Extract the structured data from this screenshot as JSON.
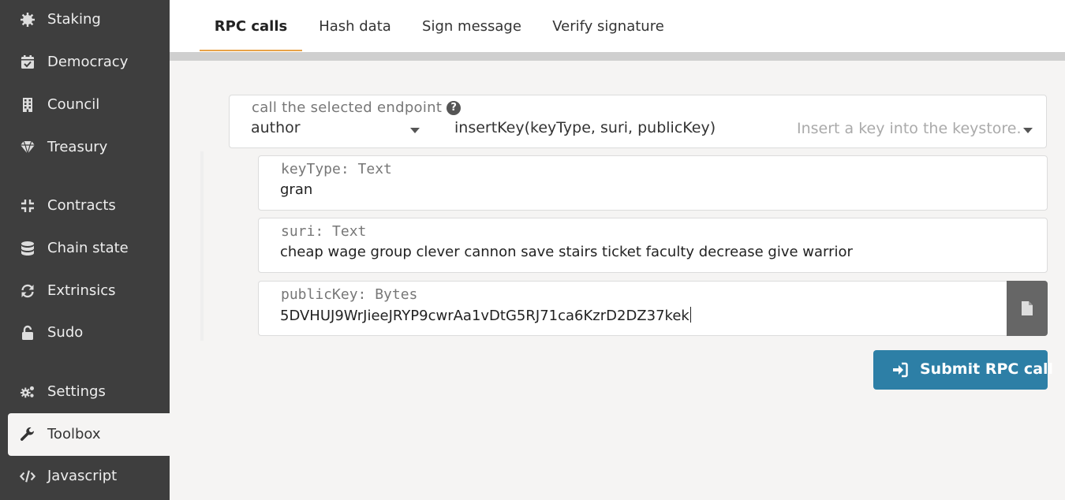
{
  "sidebar": {
    "items": [
      {
        "label": "Staking",
        "icon": "staking-icon"
      },
      {
        "label": "Democracy",
        "icon": "calendar-check-icon"
      },
      {
        "label": "Council",
        "icon": "building-icon"
      },
      {
        "label": "Treasury",
        "icon": "gem-icon"
      },
      {
        "label": "Contracts",
        "icon": "compress-icon"
      },
      {
        "label": "Chain state",
        "icon": "database-icon"
      },
      {
        "label": "Extrinsics",
        "icon": "sync-icon"
      },
      {
        "label": "Sudo",
        "icon": "unlock-icon"
      },
      {
        "label": "Settings",
        "icon": "cogs-icon"
      },
      {
        "label": "Toolbox",
        "icon": "wrench-icon",
        "active": true
      },
      {
        "label": "Javascript",
        "icon": "code-icon"
      }
    ]
  },
  "tabs": [
    {
      "label": "RPC calls",
      "active": true
    },
    {
      "label": "Hash data"
    },
    {
      "label": "Sign message"
    },
    {
      "label": "Verify signature"
    }
  ],
  "endpoint": {
    "label": "call the selected endpoint",
    "section": "author",
    "method": "insertKey(keyType, suri, publicKey)",
    "description": "Insert a key into the keystore."
  },
  "params": [
    {
      "label": "keyType: Text",
      "value": "gran"
    },
    {
      "label": "suri: Text",
      "value": "cheap wage group clever cannon save stairs ticket faculty decrease give warrior"
    },
    {
      "label": "publicKey: Bytes",
      "value": "5DVHUJ9WrJieeJRYP9cwrAa1vDtG5RJ71ca6KzrD2DZ37kek"
    }
  ],
  "submit": {
    "label": "Submit RPC call"
  },
  "colors": {
    "sidebar_bg": "#3e3e3e",
    "accent_tab": "#e8a348",
    "submit_bg": "#2d7fa6",
    "page_bg": "#f5f4f3"
  }
}
